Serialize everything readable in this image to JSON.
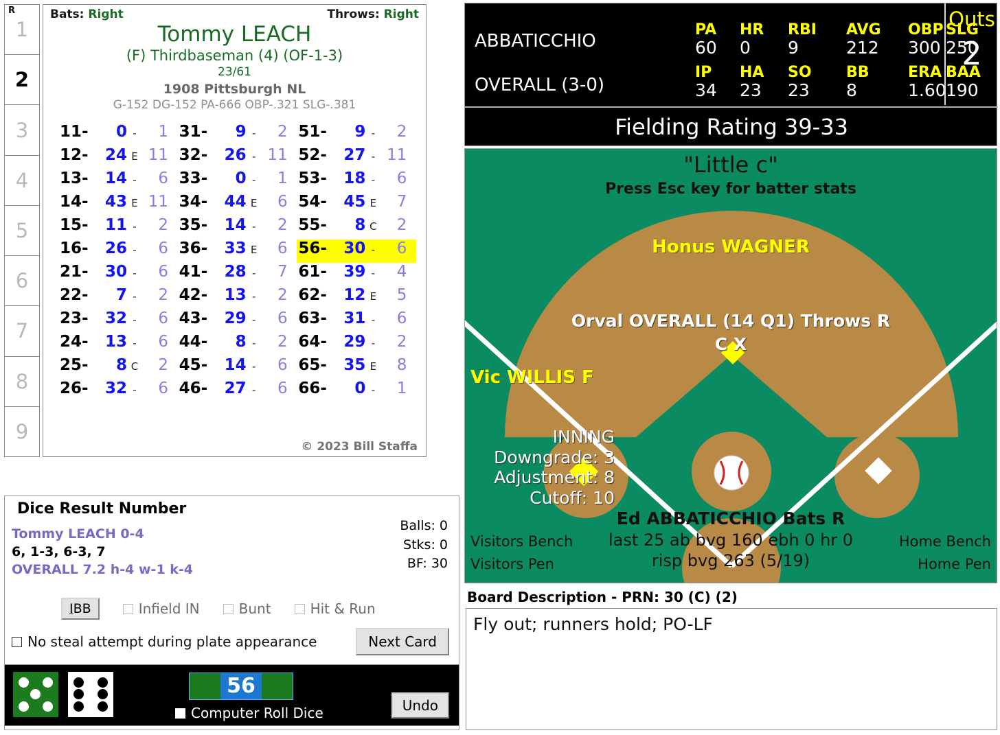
{
  "card": {
    "inning_header": "R",
    "innings": [
      "1",
      "2",
      "3",
      "4",
      "5",
      "6",
      "7",
      "8",
      "9"
    ],
    "active_inning": "2",
    "bats_label": "Bats:",
    "bats_value": "Right",
    "throws_label": "Throws:",
    "throws_value": "Right",
    "player_name": "Tommy LEACH",
    "position": "(F) Thirdbaseman (4) (OF-1-3)",
    "ratio": "23/61",
    "team": "1908 Pittsburgh NL",
    "stats_line": "G-152 DG-152 PA-666 OBP-.321 SLG-.381",
    "copyright": "© 2023 Bill Staffa",
    "results": [
      {
        "key": "11-",
        "res": "0",
        "mark": "-",
        "sec": "1",
        "hl": false
      },
      {
        "key": "31-",
        "res": "9",
        "mark": "-",
        "sec": "2",
        "hl": false
      },
      {
        "key": "51-",
        "res": "9",
        "mark": "-",
        "sec": "2",
        "hl": false
      },
      {
        "key": "12-",
        "res": "24",
        "mark": "E",
        "sec": "11",
        "hl": false
      },
      {
        "key": "32-",
        "res": "26",
        "mark": "-",
        "sec": "11",
        "hl": false
      },
      {
        "key": "52-",
        "res": "27",
        "mark": "-",
        "sec": "11",
        "hl": false
      },
      {
        "key": "13-",
        "res": "14",
        "mark": "-",
        "sec": "6",
        "hl": false
      },
      {
        "key": "33-",
        "res": "0",
        "mark": "-",
        "sec": "1",
        "hl": false
      },
      {
        "key": "53-",
        "res": "18",
        "mark": "-",
        "sec": "6",
        "hl": false
      },
      {
        "key": "14-",
        "res": "43",
        "mark": "E",
        "sec": "11",
        "hl": false
      },
      {
        "key": "34-",
        "res": "44",
        "mark": "E",
        "sec": "6",
        "hl": false
      },
      {
        "key": "54-",
        "res": "45",
        "mark": "E",
        "sec": "7",
        "hl": false
      },
      {
        "key": "15-",
        "res": "11",
        "mark": "-",
        "sec": "2",
        "hl": false
      },
      {
        "key": "35-",
        "res": "14",
        "mark": "-",
        "sec": "2",
        "hl": false
      },
      {
        "key": "55-",
        "res": "8",
        "mark": "C",
        "sec": "2",
        "hl": false
      },
      {
        "key": "16-",
        "res": "26",
        "mark": "-",
        "sec": "6",
        "hl": false
      },
      {
        "key": "36-",
        "res": "33",
        "mark": "E",
        "sec": "6",
        "hl": false
      },
      {
        "key": "56-",
        "res": "30",
        "mark": "-",
        "sec": "6",
        "hl": true
      },
      {
        "key": "21-",
        "res": "30",
        "mark": "-",
        "sec": "6",
        "hl": false
      },
      {
        "key": "41-",
        "res": "28",
        "mark": "-",
        "sec": "7",
        "hl": false
      },
      {
        "key": "61-",
        "res": "39",
        "mark": "-",
        "sec": "4",
        "hl": false
      },
      {
        "key": "22-",
        "res": "7",
        "mark": "-",
        "sec": "2",
        "hl": false
      },
      {
        "key": "42-",
        "res": "13",
        "mark": "-",
        "sec": "2",
        "hl": false
      },
      {
        "key": "62-",
        "res": "12",
        "mark": "E",
        "sec": "5",
        "hl": false
      },
      {
        "key": "23-",
        "res": "32",
        "mark": "-",
        "sec": "6",
        "hl": false
      },
      {
        "key": "43-",
        "res": "29",
        "mark": "-",
        "sec": "6",
        "hl": false
      },
      {
        "key": "63-",
        "res": "31",
        "mark": "-",
        "sec": "6",
        "hl": false
      },
      {
        "key": "24-",
        "res": "13",
        "mark": "-",
        "sec": "6",
        "hl": false
      },
      {
        "key": "44-",
        "res": "8",
        "mark": "-",
        "sec": "2",
        "hl": false
      },
      {
        "key": "64-",
        "res": "29",
        "mark": "-",
        "sec": "2",
        "hl": false
      },
      {
        "key": "25-",
        "res": "8",
        "mark": "C",
        "sec": "2",
        "hl": false
      },
      {
        "key": "45-",
        "res": "14",
        "mark": "-",
        "sec": "6",
        "hl": false
      },
      {
        "key": "65-",
        "res": "35",
        "mark": "E",
        "sec": "8",
        "hl": false
      },
      {
        "key": "26-",
        "res": "32",
        "mark": "-",
        "sec": "6",
        "hl": false
      },
      {
        "key": "46-",
        "res": "27",
        "mark": "-",
        "sec": "6",
        "hl": false
      },
      {
        "key": "66-",
        "res": "0",
        "mark": "-",
        "sec": "1",
        "hl": false
      }
    ]
  },
  "dice_panel": {
    "title": "Dice Result Number",
    "line1": "Tommy LEACH  0-4",
    "line2": "6, 1-3, 6-3, 7",
    "line3": "OVERALL  7.2  h-4  w-1  k-4",
    "balls": "Balls: 0",
    "strikes": "Stks: 0",
    "bf": "BF: 30",
    "ibb_label": "IBB",
    "infield_in_label": "Infield IN",
    "bunt_label": "Bunt",
    "hit_run_label": "Hit & Run",
    "no_steal_label": "No steal attempt during plate appearance",
    "next_card_label": "Next Card",
    "computer_roll_label": "Computer Roll Dice",
    "undo_label": "Undo",
    "roll_value": "56",
    "die_green_pips": 5,
    "die_white_pips": 6
  },
  "scoreboard": {
    "batter_name": "ABBATICCHIO",
    "batter_headers": [
      "PA",
      "HR",
      "RBI",
      "AVG",
      "OBP",
      "SLG"
    ],
    "batter_values": [
      "60",
      "0",
      "9",
      "212",
      "300",
      "250"
    ],
    "pitcher_name": "OVERALL (3-0)",
    "pitcher_headers": [
      "IP",
      "HA",
      "SO",
      "BB",
      "ERA",
      "BAA"
    ],
    "pitcher_values": [
      "34",
      "23",
      "23",
      "8",
      "1.60",
      "190"
    ],
    "outs_label": "Outs",
    "outs_value": "2",
    "fielding_rating": "Fielding Rating 39-33"
  },
  "field": {
    "nickname": "\"Little c\"",
    "esc_hint": "Press Esc key for batter stats",
    "shortstop": "Honus WAGNER",
    "pitcher_line1": "Orval OVERALL (14 Q1) Throws R",
    "pitcher_line2": "C X",
    "third_base_runner": "Vic WILLIS F",
    "inning_title": "INNING",
    "downgrade": "Downgrade: 3",
    "adjustment": "Adjustment: 8",
    "cutoff": "Cutoff: 10",
    "batter_line1": "Ed ABBATICCHIO Bats R",
    "batter_line2": "last 25 ab bvg 160 ebh 0 hr 0",
    "batter_line3": "risp bvg 263 (5/19)",
    "visitors_bench": "Visitors Bench",
    "visitors_pen": "Visitors Pen",
    "home_bench": "Home Bench",
    "home_pen": "Home Pen"
  },
  "board": {
    "label": "Board Description - PRN: 30 (C) (2)",
    "text": "Fly out; runners hold; PO-LF"
  },
  "colors": {
    "field_green": "#0a8b62",
    "field_dirt": "#b98a45",
    "highlight_yellow": "#ffff00",
    "result_blue": "#1414ef",
    "secondary_purple": "#8a7fe0",
    "name_green": "#176b23"
  }
}
